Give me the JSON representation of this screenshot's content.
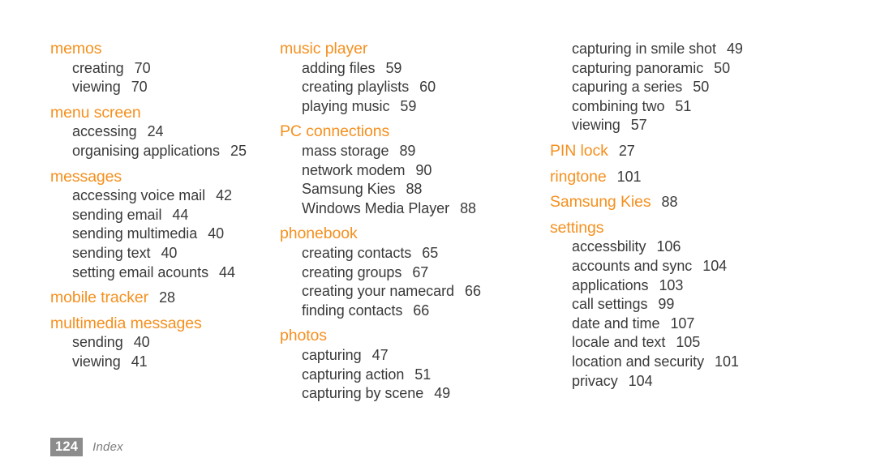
{
  "document": {
    "section_title": "Index",
    "page_number": "124",
    "heading_color": "#F5901E",
    "body_color": "#3a3a3a",
    "folio_background": "#8c8c8c",
    "background_color": "#ffffff"
  },
  "columns": [
    {
      "id": "column-1",
      "groups": [
        {
          "heading": "memos",
          "heading_page": "",
          "entries": [
            {
              "label": "creating",
              "page": "70"
            },
            {
              "label": "viewing",
              "page": "70"
            }
          ]
        },
        {
          "heading": "menu screen",
          "heading_page": "",
          "entries": [
            {
              "label": "accessing",
              "page": "24"
            },
            {
              "label": "organising applications",
              "page": "25"
            }
          ]
        },
        {
          "heading": "messages",
          "heading_page": "",
          "entries": [
            {
              "label": "accessing voice mail",
              "page": "42"
            },
            {
              "label": "sending email",
              "page": "44"
            },
            {
              "label": "sending multimedia",
              "page": "40"
            },
            {
              "label": "sending text",
              "page": "40"
            },
            {
              "label": "setting email acounts",
              "page": "44"
            }
          ]
        },
        {
          "heading": "mobile tracker",
          "heading_page": "28",
          "entries": []
        },
        {
          "heading": "multimedia messages",
          "heading_page": "",
          "entries": [
            {
              "label": "sending",
              "page": "40"
            },
            {
              "label": "viewing",
              "page": "41"
            }
          ]
        }
      ]
    },
    {
      "id": "column-2",
      "groups": [
        {
          "heading": "music player",
          "heading_page": "",
          "entries": [
            {
              "label": "adding files",
              "page": "59"
            },
            {
              "label": "creating playlists",
              "page": "60"
            },
            {
              "label": "playing music",
              "page": "59"
            }
          ]
        },
        {
          "heading": "PC connections",
          "heading_page": "",
          "entries": [
            {
              "label": "mass storage",
              "page": "89"
            },
            {
              "label": "network modem",
              "page": "90"
            },
            {
              "label": "Samsung Kies",
              "page": "88"
            },
            {
              "label": "Windows Media Player",
              "page": "88"
            }
          ]
        },
        {
          "heading": "phonebook",
          "heading_page": "",
          "entries": [
            {
              "label": "creating contacts",
              "page": "65"
            },
            {
              "label": "creating groups",
              "page": "67"
            },
            {
              "label": "creating your namecard",
              "page": "66"
            },
            {
              "label": "finding contacts",
              "page": "66"
            }
          ]
        },
        {
          "heading": "photos",
          "heading_page": "",
          "entries": [
            {
              "label": "capturing",
              "page": "47"
            },
            {
              "label": "capturing action",
              "page": "51"
            },
            {
              "label": "capturing by scene",
              "page": "49"
            }
          ]
        }
      ]
    },
    {
      "id": "column-3",
      "continuation_entries": [
        {
          "label": "capturing in smile shot",
          "page": "49"
        },
        {
          "label": "capturing panoramic",
          "page": "50"
        },
        {
          "label": "capuring a series",
          "page": "50"
        },
        {
          "label": "combining two",
          "page": "51"
        },
        {
          "label": "viewing",
          "page": "57"
        }
      ],
      "groups": [
        {
          "heading": "PIN lock",
          "heading_page": "27",
          "entries": []
        },
        {
          "heading": "ringtone",
          "heading_page": "101",
          "entries": []
        },
        {
          "heading": "Samsung Kies",
          "heading_page": "88",
          "entries": []
        },
        {
          "heading": "settings",
          "heading_page": "",
          "entries": [
            {
              "label": "accessbility",
              "page": "106"
            },
            {
              "label": "accounts and sync",
              "page": "104"
            },
            {
              "label": "applications",
              "page": "103"
            },
            {
              "label": "call settings",
              "page": "99"
            },
            {
              "label": "date and time",
              "page": "107"
            },
            {
              "label": "locale and text",
              "page": "105"
            },
            {
              "label": "location and security",
              "page": "101"
            },
            {
              "label": "privacy",
              "page": "104"
            }
          ]
        }
      ]
    }
  ]
}
